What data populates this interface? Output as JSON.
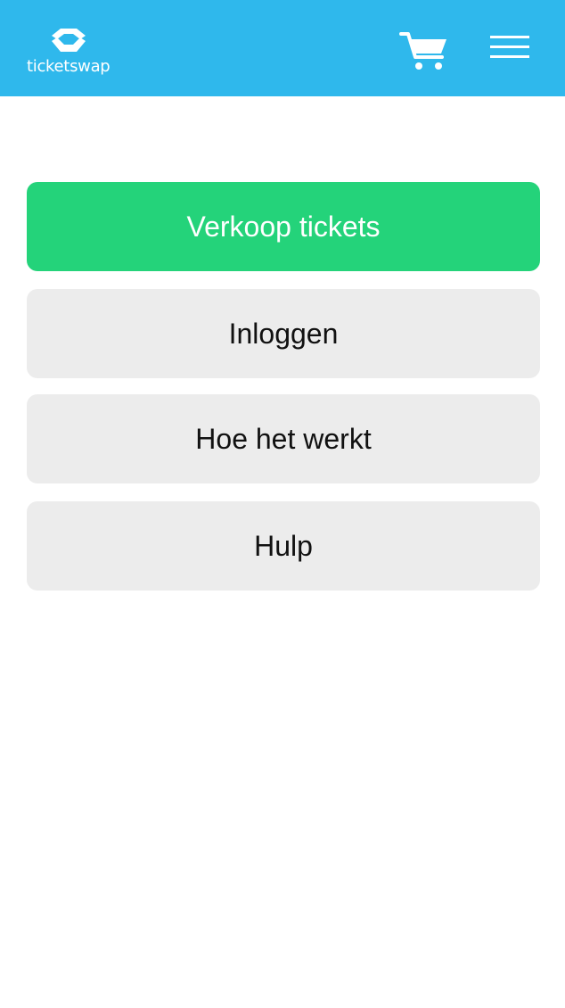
{
  "header": {
    "logo_text": "ticketswap",
    "brand_color": "#2fb8ec",
    "cart_icon": "shopping-cart-icon",
    "menu_icon": "hamburger-menu-icon"
  },
  "menu": {
    "sell_tickets": "Verkoop tickets",
    "login": "Inloggen",
    "how_it_works": "Hoe het werkt",
    "help": "Hulp"
  },
  "colors": {
    "primary_button": "#24d37a",
    "secondary_button": "#ececec"
  }
}
